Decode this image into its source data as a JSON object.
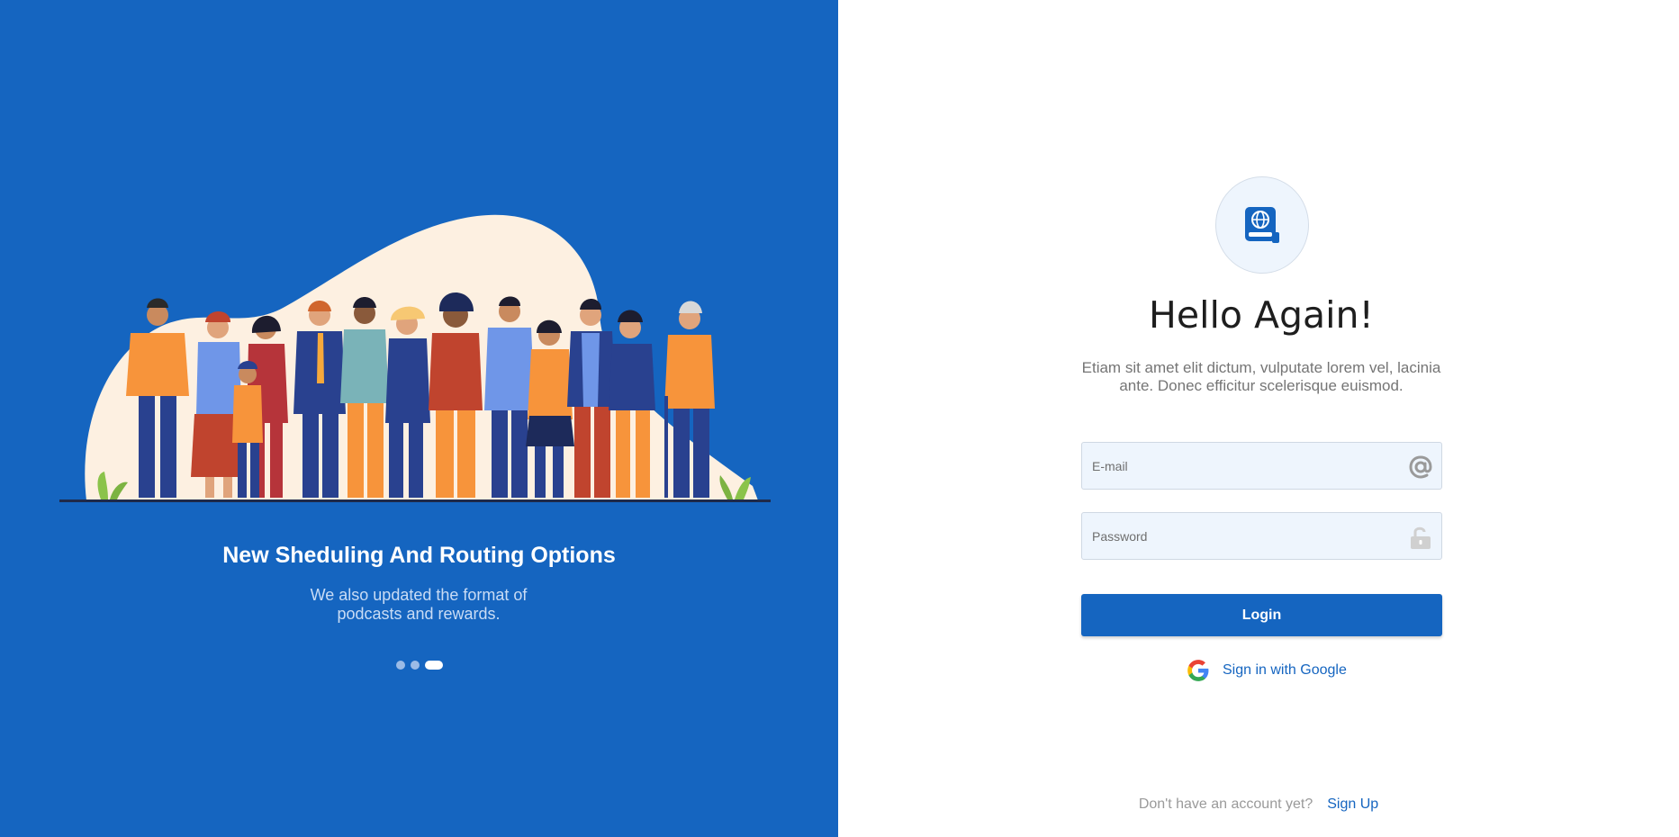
{
  "left_panel": {
    "slide_title": "New Sheduling And Routing Options",
    "slide_subtitle": "We also updated the format of podcasts and rewards.",
    "carousel": {
      "count": 3,
      "active_index": 2
    },
    "background_color": "#1565c0"
  },
  "right_panel": {
    "logo_icon": "globe-book-icon",
    "heading": "Hello Again!",
    "description": "Etiam sit amet elit dictum, vulputate lorem vel, lacinia ante. Donec efficitur scelerisque euismod.",
    "email": {
      "placeholder": "E-mail",
      "value": "",
      "icon": "at-sign-icon"
    },
    "password": {
      "placeholder": "Password",
      "value": "",
      "icon": "lock-icon"
    },
    "login_label": "Login",
    "google_label": "Sign in with Google",
    "signup_prompt": "Don't have an account yet?",
    "signup_link": "Sign Up",
    "accent_color": "#1565c0"
  }
}
